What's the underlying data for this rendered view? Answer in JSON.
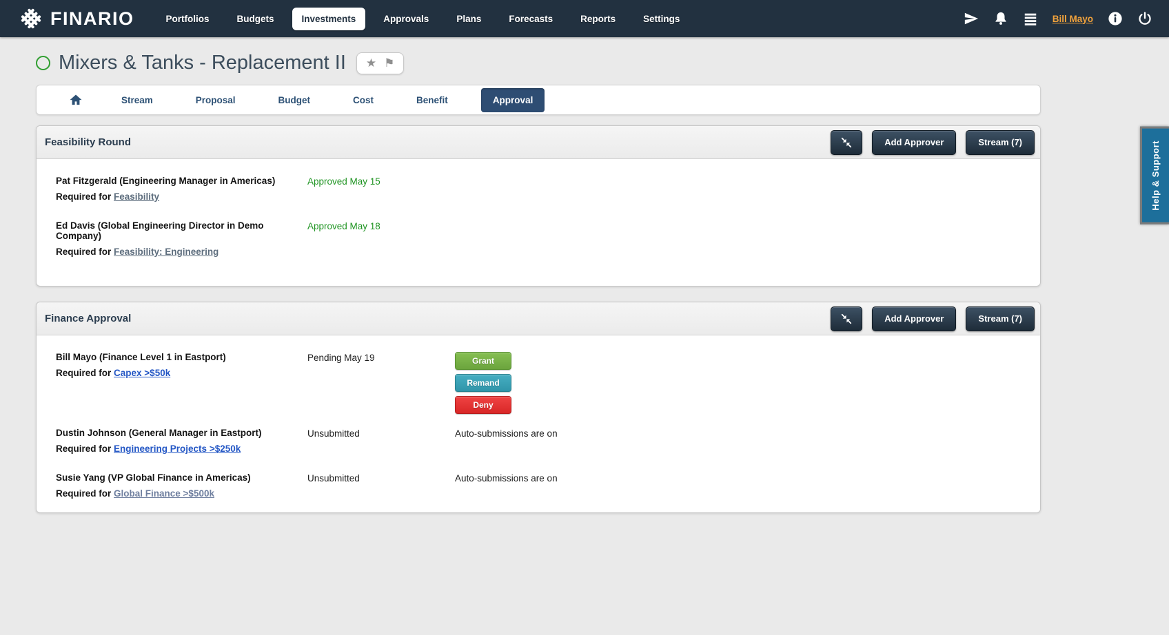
{
  "colors": {
    "navbar_bg": "#223140",
    "accent_navy": "#2e4d73",
    "tab_text_navy": "#2d5175",
    "approved_green": "#1f9422",
    "status_circle_green": "#2f9e2f",
    "user_link_orange": "#f2a33c",
    "link_blue": "#2457c5",
    "link_gray": "#5e6e7e",
    "grant_green": "#76b043",
    "remand_teal": "#3ba3b8",
    "deny_red": "#e13333",
    "help_tab_blue": "#1d6f9b"
  },
  "icons": {
    "star": "★",
    "flag": "⚑"
  },
  "navbar": {
    "brand": "FINARIO",
    "items": [
      {
        "label": "Portfolios",
        "active": false
      },
      {
        "label": "Budgets",
        "active": false
      },
      {
        "label": "Investments",
        "active": true
      },
      {
        "label": "Approvals",
        "active": false
      },
      {
        "label": "Plans",
        "active": false
      },
      {
        "label": "Forecasts",
        "active": false
      },
      {
        "label": "Reports",
        "active": false
      },
      {
        "label": "Settings",
        "active": false
      }
    ],
    "user_label": "Bill Mayo"
  },
  "page_title": "Mixers & Tanks - Replacement II",
  "tabs": {
    "items": [
      "Stream",
      "Proposal",
      "Budget",
      "Cost",
      "Benefit",
      "Approval"
    ],
    "active": "Approval"
  },
  "panels": [
    {
      "title": "Feasibility Round",
      "buttons": {
        "add_approver": "Add Approver",
        "stream": "Stream (7)"
      },
      "approvers": [
        {
          "name": "Pat Fitzgerald (Engineering Manager in Americas)",
          "required_prefix": "Required for",
          "required_link": "Feasibility",
          "status": "Approved May 15"
        },
        {
          "name": "Ed Davis (Global Engineering Director in Demo Company)",
          "required_prefix": "Required for",
          "required_link": "Feasibility: Engineering",
          "status": "Approved May 18"
        }
      ]
    },
    {
      "title": "Finance Approval",
      "buttons": {
        "add_approver": "Add Approver",
        "stream": "Stream (7)"
      },
      "approvers": [
        {
          "name": "Bill Mayo (Finance Level 1 in Eastport)",
          "required_prefix": "Required for",
          "required_link": "Capex >$50k",
          "status": "Pending May 19",
          "actions": {
            "grant": "Grant",
            "remand": "Remand",
            "deny": "Deny"
          }
        },
        {
          "name": "Dustin Johnson (General Manager in Eastport)",
          "required_prefix": "Required for",
          "required_link": "Engineering Projects >$250k",
          "status": "Unsubmitted",
          "note": "Auto-submissions are on"
        },
        {
          "name": "Susie Yang (VP Global Finance in Americas)",
          "required_prefix": "Required for",
          "required_link": "Global Finance >$500k",
          "status": "Unsubmitted",
          "note": "Auto-submissions are on"
        }
      ]
    }
  ],
  "help_tab_label": "Help & Support"
}
